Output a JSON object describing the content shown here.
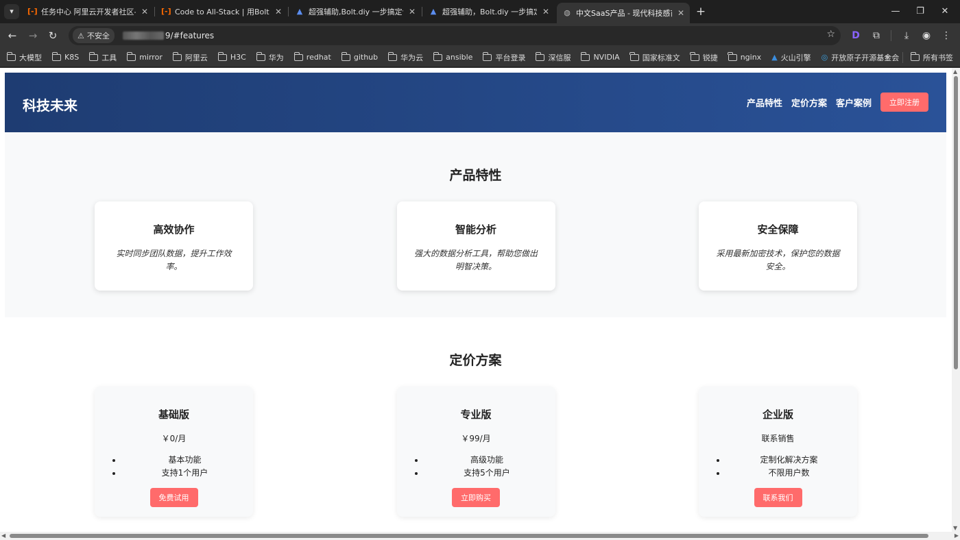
{
  "browser": {
    "tabs": [
      {
        "title": "任务中心 阿里云开发者社区-云...",
        "icon": "aliyun-icon"
      },
      {
        "title": "Code to All-Stack | 用Bolt.diy...",
        "icon": "aliyun-icon"
      },
      {
        "title": "超强辅助,Bolt.diy 一步搞定创...",
        "icon": "bolt-icon"
      },
      {
        "title": "超强辅助，Bolt.diy 一步搞定创...",
        "icon": "bolt-icon"
      },
      {
        "title": "中文SaaS产品 - 现代科技感首页",
        "icon": "globe-icon"
      }
    ],
    "security_label": "不安全",
    "url": "9/#features",
    "bookmarks": [
      "大模型",
      "K8S",
      "工具",
      "mirror",
      "阿里云",
      "H3C",
      "华为",
      "redhat",
      "github",
      "华为云",
      "ansible",
      "平台登录",
      "深信服",
      "NVIDIA",
      "国家标准文",
      "锐捷",
      "nginx",
      "火山引擎",
      "开放原子开源基金会"
    ],
    "all_bookmarks": "所有书签"
  },
  "site": {
    "logo": "科技未来",
    "nav": [
      "产品特性",
      "定价方案",
      "客户案例"
    ],
    "signup": "立即注册",
    "features": {
      "title": "产品特性",
      "cards": [
        {
          "title": "高效协作",
          "desc": "实时同步团队数据，提升工作效率。"
        },
        {
          "title": "智能分析",
          "desc": "强大的数据分析工具，帮助您做出明智决策。"
        },
        {
          "title": "安全保障",
          "desc": "采用最新加密技术，保护您的数据安全。"
        }
      ]
    },
    "pricing": {
      "title": "定价方案",
      "plans": [
        {
          "name": "基础版",
          "price": "￥0/月",
          "items": [
            "基本功能",
            "支持1个用户"
          ],
          "button": "免费试用"
        },
        {
          "name": "专业版",
          "price": "￥99/月",
          "items": [
            "高级功能",
            "支持5个用户"
          ],
          "button": "立即购买"
        },
        {
          "name": "企业版",
          "price": "联系销售",
          "items": [
            "定制化解决方案",
            "不限用户数"
          ],
          "button": "联系我们"
        }
      ]
    }
  },
  "colors": {
    "header_gradient_start": "#1e3c72",
    "header_gradient_end": "#2a5298",
    "accent": "#ff6b6b",
    "section_bg": "#f8f9fa"
  }
}
